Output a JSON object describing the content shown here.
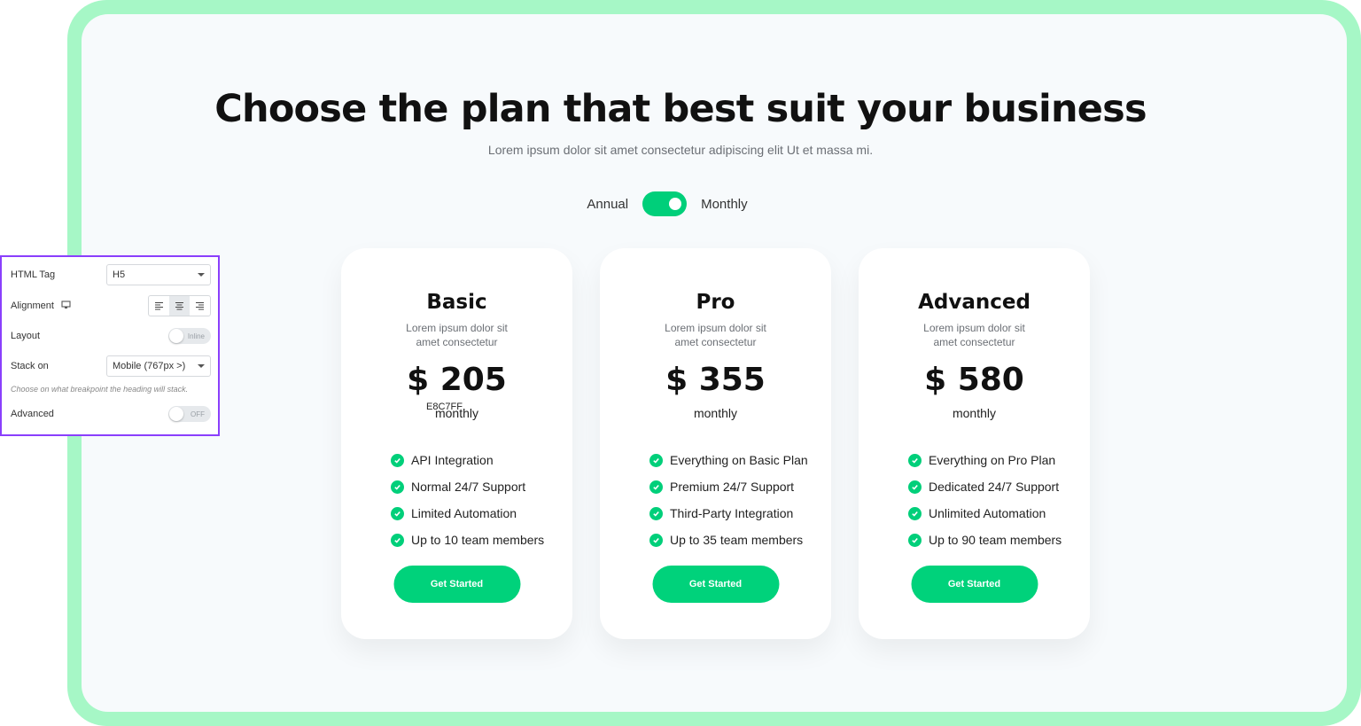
{
  "hero": {
    "title": "Choose the plan that best suit your business",
    "subtitle": "Lorem ipsum dolor sit amet consectetur adipiscing elit Ut et massa mi."
  },
  "billing_toggle": {
    "left_label": "Annual",
    "right_label": "Monthly",
    "state": "on",
    "color": "#00cf7a"
  },
  "plans": [
    {
      "name": "Basic",
      "description": "Lorem ipsum dolor sit amet consectetur",
      "price": "$ 205",
      "period": "monthly",
      "stray_text": "E8C7FF",
      "features": [
        "API Integration",
        "Normal 24/7 Support",
        "Limited Automation",
        "Up to 10 team members"
      ],
      "cta": "Get Started"
    },
    {
      "name": "Pro",
      "description": "Lorem ipsum dolor sit amet consectetur",
      "price": "$ 355",
      "period": "monthly",
      "features": [
        "Everything on Basic Plan",
        "Premium 24/7 Support",
        "Third-Party Integration",
        "Up to 35 team members"
      ],
      "cta": "Get Started"
    },
    {
      "name": "Advanced",
      "description": "Lorem ipsum dolor sit amet consectetur",
      "price": "$ 580",
      "period": "monthly",
      "features": [
        "Everything on Pro Plan",
        "Dedicated 24/7 Support",
        "Unlimited Automation",
        "Up to 90 team members"
      ],
      "cta": "Get Started"
    }
  ],
  "settings_panel": {
    "html_tag": {
      "label": "HTML Tag",
      "value": "H5"
    },
    "alignment": {
      "label": "Alignment",
      "icon": "desktop-icon",
      "selected": "center"
    },
    "layout": {
      "label": "Layout",
      "toggle_text": "Inline"
    },
    "stack_on": {
      "label": "Stack on",
      "value": "Mobile (767px >)"
    },
    "hint": "Choose on what breakpoint the heading will stack.",
    "advanced": {
      "label": "Advanced",
      "toggle_text": "OFF"
    },
    "border_color": "#8a3ffc"
  },
  "colors": {
    "accent": "#00d27b",
    "frame": "#a6f7c6",
    "background": "#f7fafc"
  }
}
